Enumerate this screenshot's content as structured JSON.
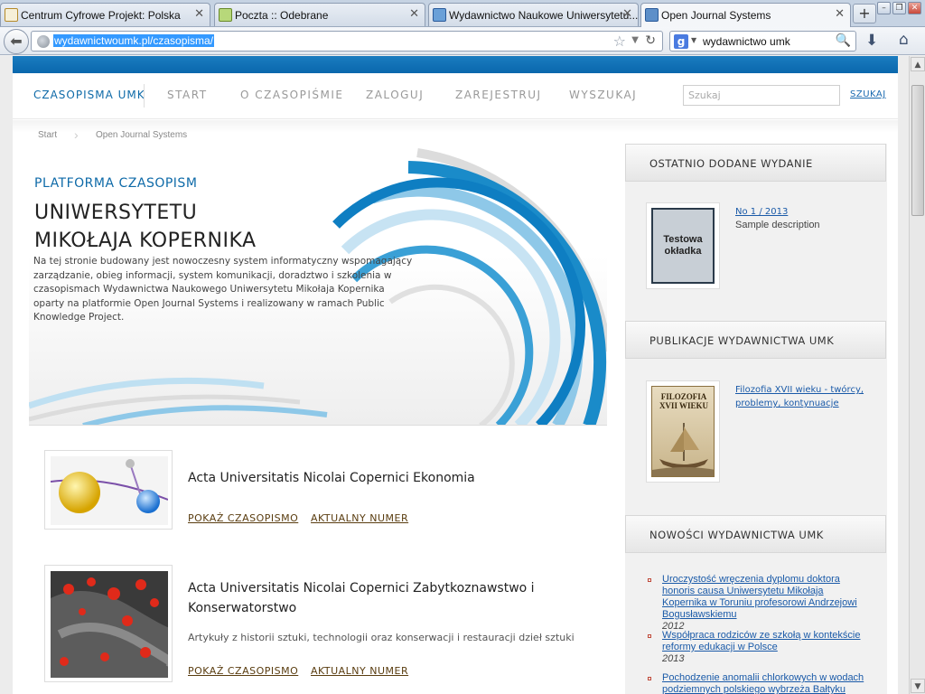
{
  "browser": {
    "tabs": [
      {
        "label": "Centrum Cyfrowe Projekt: Polska"
      },
      {
        "label": "Poczta :: Odebrane"
      },
      {
        "label": "Wydawnictwo Naukowe Uniwersytetu..."
      },
      {
        "label": "Open Journal Systems"
      }
    ],
    "url": "wydawnictwoumk.pl/czasopisma/",
    "search_engine_letter": "g",
    "search_query": "wydawnictwo umk"
  },
  "site": {
    "brand": "CZASOPISMA UMK",
    "menu": [
      "START",
      "O CZASOPIŚMIE",
      "ZALOGUJ",
      "ZAREJESTRUJ",
      "WYSZUKAJ"
    ],
    "search_placeholder": "Szukaj",
    "search_button": "SZUKAJ"
  },
  "breadcrumb": [
    "Start",
    "Open Journal Systems"
  ],
  "hero": {
    "kicker": "PLATFORMA CZASOPISM",
    "title_line1": "UNIWERSYTETU",
    "title_line2": "MIKOŁAJA KOPERNIKA",
    "description": "Na tej stronie budowany jest nowoczesny system informatyczny wspomagający zarządzanie, obieg informacji, system komunikacji, doradztwo i szkolenia w czasopismach Wydawnictwa Naukowego Uniwersytetu Mikołaja Kopernika oparty na platformie Open Journal Systems i realizowany w ramach Public Knowledge Project."
  },
  "journals": [
    {
      "title": "Acta Universitatis Nicolai Copernici Ekonomia",
      "description": "",
      "show_label": "POKAŻ CZASOPISMO",
      "current_label": "AKTUALNY NUMER"
    },
    {
      "title": "Acta Universitatis Nicolai Copernici Zabytkoznawstwo i Konserwatorstwo",
      "description": "Artykuły z historii sztuki, technologii oraz konserwacji i restauracji dzieł sztuki",
      "show_label": "POKAŻ CZASOPISMO",
      "current_label": "AKTUALNY NUMER"
    }
  ],
  "sidebar": {
    "latest": {
      "heading": "OSTATNIO DODANE WYDANIE",
      "cover_text": "Testowa okładka",
      "issue_link": "No 1 / 2013",
      "issue_desc": "Sample description"
    },
    "publications": {
      "heading": "PUBLIKACJE WYDAWNICTWA UMK",
      "book_cover_title": "FILOZOFIA XVII WIEKU",
      "book_link": "Filozofia XVII wieku - twórcy, problemy, kontynuacje"
    },
    "news": {
      "heading": "NOWOŚCI WYDAWNICTWA UMK",
      "items": [
        {
          "title": "Uroczystość wręczenia dyplomu doktora honoris causa Uniwersytetu Mikołaja Kopernika w Toruniu profesorowi Andrzejowi Bogusławskiemu",
          "year": "2012"
        },
        {
          "title": "Współpraca rodziców ze szkołą w kontekście reformy edukacji w Polsce",
          "year": "2013"
        },
        {
          "title": "Pochodzenie anomalii chlorkowych w wodach podziemnych polskiego wybrzeża Bałtyku",
          "year": ""
        }
      ]
    }
  },
  "colors": {
    "accent": "#0e6aa8",
    "bar": "#0a67ad",
    "link": "#1a5aa8"
  }
}
